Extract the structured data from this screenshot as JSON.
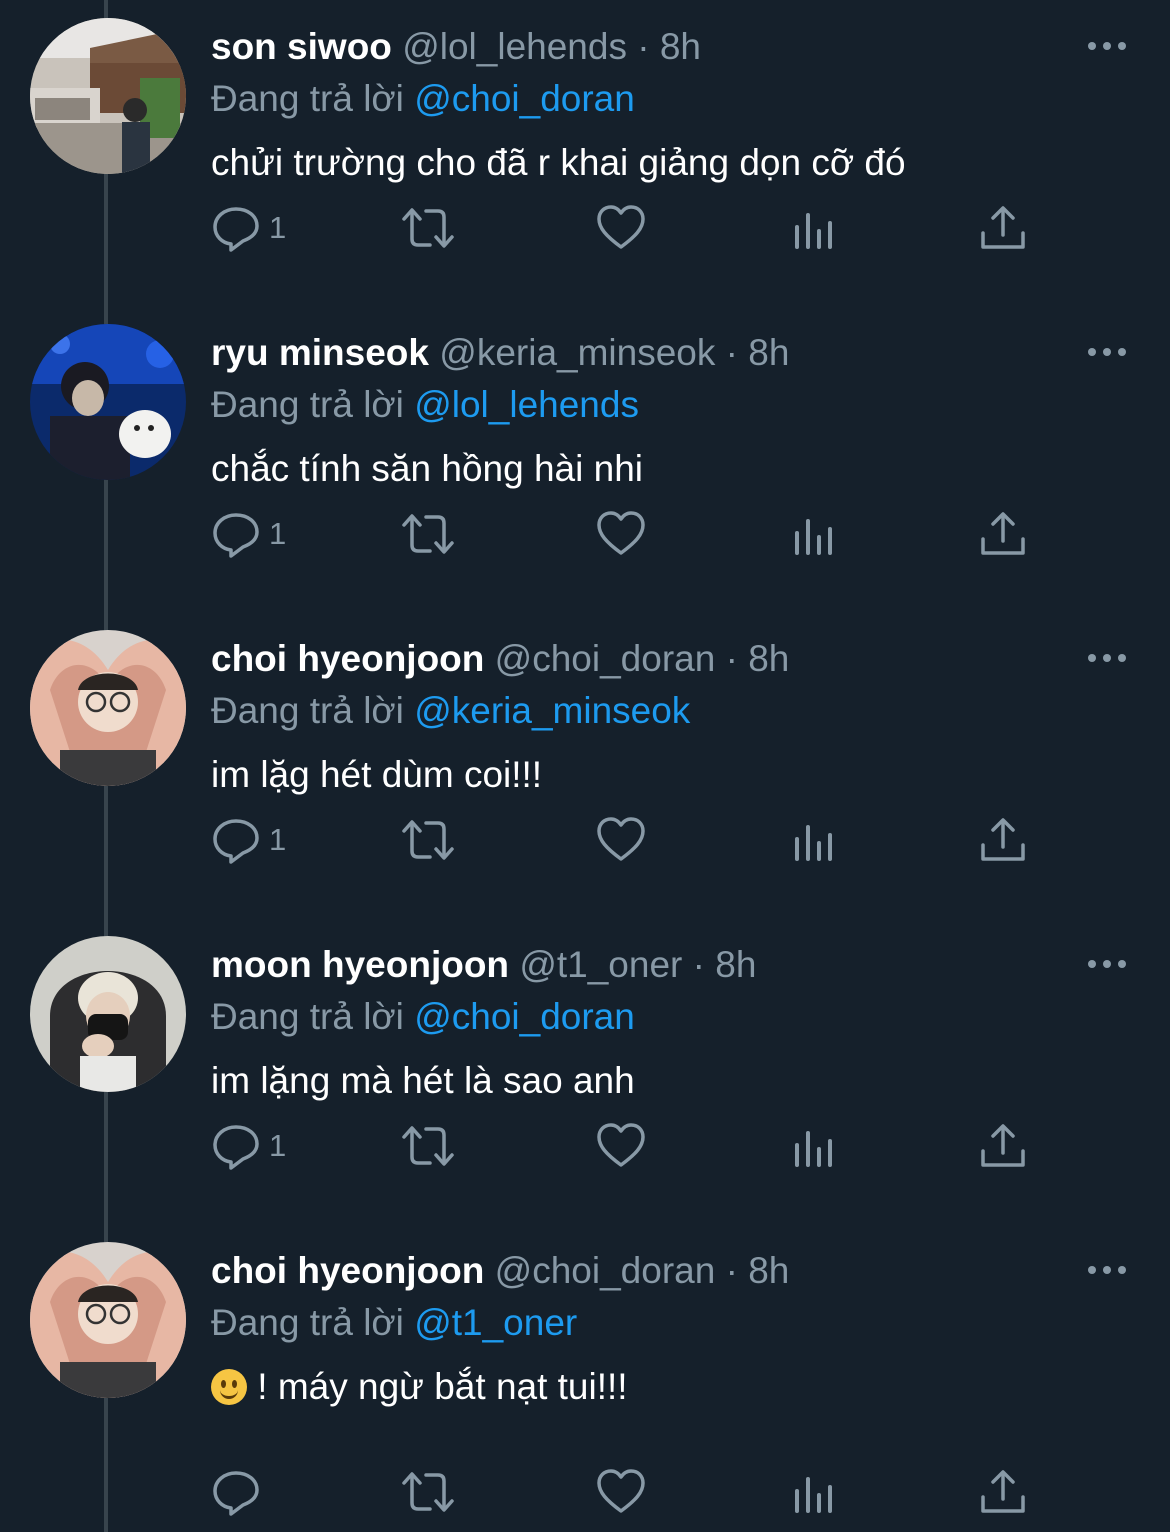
{
  "reply_prefix": "Đang trả lời",
  "tweets": [
    {
      "name": "son siwoo",
      "handle": "@lol_lehends",
      "dot": "·",
      "time": "8h",
      "reply_to": "@choi_doran",
      "text": "chửi trường cho đã r khai giảng dọn cỡ đó",
      "reply_count": "1",
      "avatar": "photo-street"
    },
    {
      "name": "ryu minseok",
      "handle": "@keria_minseok",
      "dot": "·",
      "time": "8h",
      "reply_to": "@lol_lehends",
      "text": "chắc tính săn hồng hài nhi",
      "reply_count": "1",
      "avatar": "photo-blue-night"
    },
    {
      "name": "choi hyeonjoon",
      "handle": "@choi_doran",
      "dot": "·",
      "time": "8h",
      "reply_to": "@keria_minseok",
      "text": "im lặg hét dùm coi!!!",
      "reply_count": "1",
      "avatar": "photo-heart-hands"
    },
    {
      "name": "moon hyeonjoon",
      "handle": "@t1_oner",
      "dot": "·",
      "time": "8h",
      "reply_to": "@choi_doran",
      "text": "im lặng mà hét là sao anh",
      "reply_count": "1",
      "avatar": "photo-hooded"
    },
    {
      "name": "choi hyeonjoon",
      "handle": "@choi_doran",
      "dot": "·",
      "time": "8h",
      "reply_to": "@t1_oner",
      "text": "! máy ngừ bắt nạt tui!!!",
      "reply_count": "",
      "avatar": "photo-heart-hands",
      "emoji": "slightly-smiling-face"
    }
  ],
  "icons": {
    "reply": "reply-icon",
    "retweet": "retweet-icon",
    "like": "heart-icon",
    "views": "analytics-icon",
    "share": "share-icon",
    "more": "more-icon"
  },
  "colors": {
    "background": "#15202b",
    "secondary_text": "#8899a6",
    "mention": "#1d9bf0",
    "thread_line": "#38444d"
  }
}
